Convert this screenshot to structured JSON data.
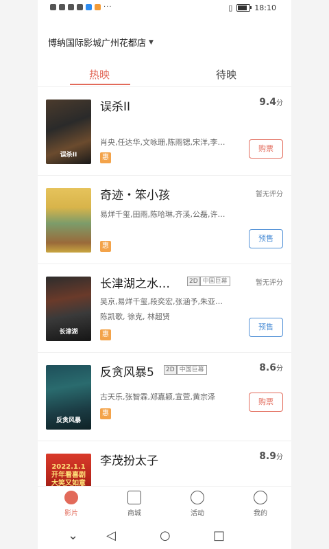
{
  "status_bar": {
    "time": "18:10",
    "more": "···",
    "battery_level": 0.7
  },
  "cinema": {
    "name": "博纳国际影城广州花都店"
  },
  "tabs": [
    {
      "label": "热映"
    },
    {
      "label": "待映"
    }
  ],
  "movies": [
    {
      "title": "误杀II",
      "score": "9.4",
      "score_unit": "分",
      "cast": "肖央,任达华,文咏珊,陈雨锶,宋洋,李…",
      "badge": "惠",
      "button": "购票",
      "poster_text": "误杀II"
    },
    {
      "title": "奇迹・笨小孩",
      "no_score": "暂无评分",
      "cast": "易烊千玺,田雨,陈哈琳,齐溪,公磊,许…",
      "badge": "惠",
      "button": "预售"
    },
    {
      "title": "长津湖之水…",
      "tag_2d": "2D",
      "tag_cn": "中国巨幕",
      "no_score": "暂无评分",
      "cast": "吴京,易烊千玺,段奕宏,张涵予,朱亚…",
      "cast2": "陈凯歌, 徐克, 林超贤",
      "badge": "惠",
      "button": "预售",
      "poster_text": "长津湖"
    },
    {
      "title": "反贪风暴5",
      "tag_2d": "2D",
      "tag_cn": "中国巨幕",
      "score": "8.6",
      "score_unit": "分",
      "cast": "古天乐,张智霖,郑嘉颖,宣萱,黄宗泽",
      "badge": "惠",
      "button": "购票",
      "poster_text": "反贪风暴"
    },
    {
      "title": "李茂扮太子",
      "score": "8.9",
      "score_unit": "分",
      "poster_text": "2022.1.1\n开年看喜剧\n大笑又如意"
    }
  ],
  "bottom_nav": [
    {
      "label": "影片"
    },
    {
      "label": "商城"
    },
    {
      "label": "活动"
    },
    {
      "label": "我的"
    }
  ],
  "system_nav": {
    "down": "⌄",
    "back": "◁",
    "home": "○",
    "recent": "□"
  }
}
